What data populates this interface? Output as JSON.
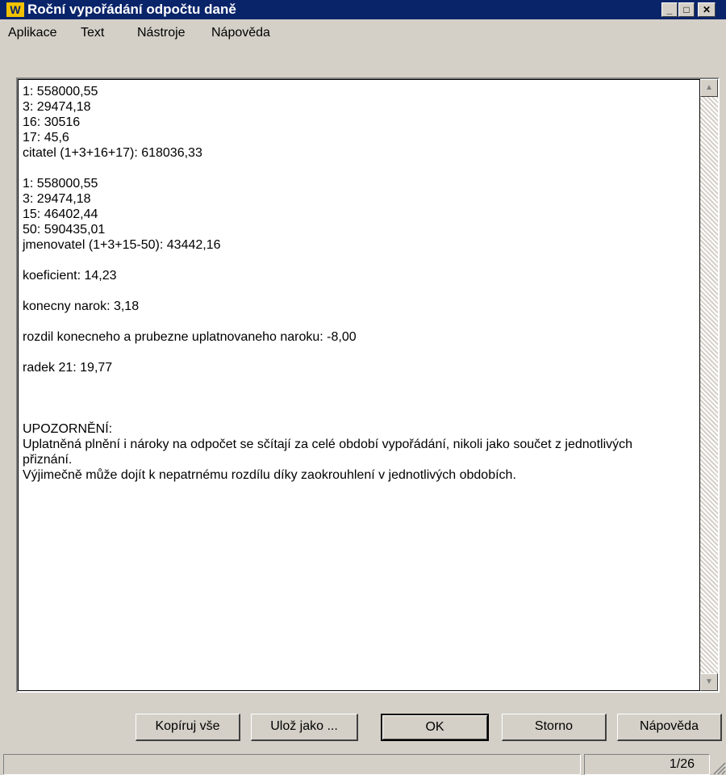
{
  "window": {
    "logo": "W",
    "title": "Roční vypořádání odpočtu daně",
    "controls": {
      "minimize": "_",
      "maximize": "□",
      "close": "✕"
    }
  },
  "menu": [
    "Aplikace",
    "Text",
    "Nástroje",
    "Nápověda"
  ],
  "content": {
    "block1": [
      "1: 558000,55",
      "3: 29474,18",
      "16: 30516",
      "17: 45,6",
      "citatel (1+3+16+17): 618036,33"
    ],
    "block2": [
      "1: 558000,55",
      "3: 29474,18",
      "15: 46402,44",
      "50: 590435,01",
      "jmenovatel (1+3+15-50): 43442,16"
    ],
    "koeficient": "koeficient: 14,23",
    "konecny": "konecny narok: 3,18",
    "rozdil": "rozdil konecneho a prubezne uplatnovaneho naroku: -8,00",
    "radek": "radek 21: 19,77",
    "warning_title": "UPOZORNĚNÍ:",
    "warning_text1": "Uplatněná plnění i nároky na odpočet se sčítají za celé období vypořádání, nikoli jako součet z jednotlivých přiznání.",
    "warning_text2": "Výjimečně může dojít k nepatrnému rozdílu díky zaokrouhlení v jednotlivých obdobích."
  },
  "scrollbar": {
    "up": "▲",
    "down": "▼"
  },
  "buttons": {
    "copy": "Kopíruj vše",
    "save": "Ulož jako ...",
    "ok": "OK",
    "cancel": "Storno",
    "help": "Nápověda"
  },
  "status": {
    "page": "1/26"
  }
}
